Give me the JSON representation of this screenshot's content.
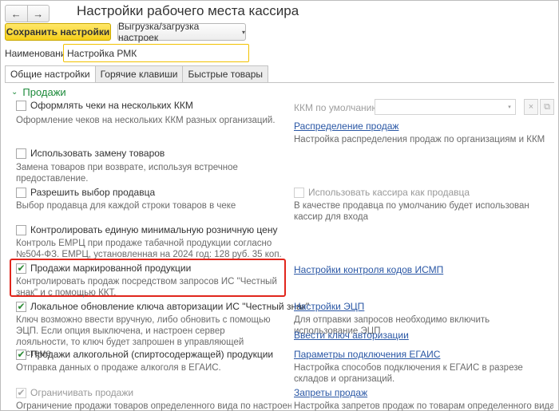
{
  "window": {
    "title": "Настройки рабочего места кассира",
    "nav_back": "←",
    "nav_forward": "→"
  },
  "toolbar": {
    "save_label": "Сохранить настройки",
    "export_label": "Выгрузка/загрузка настроек",
    "export_caret": "▾"
  },
  "name_field": {
    "label": "Наименование:",
    "value": "Настройка РМК"
  },
  "tabs": [
    {
      "label": "Общие настройки",
      "active": true
    },
    {
      "label": "Горячие клавиши",
      "active": false
    },
    {
      "label": "Быстрые товары",
      "active": false
    }
  ],
  "group": {
    "title": "Продажи",
    "chevron": "⌄"
  },
  "settings": [
    {
      "label": "Оформлять чеки на нескольких ККМ",
      "checked": false,
      "desc": "Оформление чеков на нескольких ККМ разных организаций."
    },
    {
      "label": "Использовать замену товаров",
      "checked": false,
      "desc": "Замена товаров при возврате, используя встречное предоставление."
    },
    {
      "label": "Разрешить выбор продавца",
      "checked": false,
      "desc": "Выбор продавца для каждой строки товаров в чеке"
    },
    {
      "label": "Контролировать единую минимальную розничную цену",
      "checked": false,
      "desc": "Контроль ЕМРЦ при продаже табачной продукции согласно №504-ФЗ. ЕМРЦ, установленная на 2024 год: 128 руб. 35 коп."
    },
    {
      "label": "Продажи маркированной продукции",
      "checked": true,
      "desc": "Контролировать продаж посредством запросов ИС \"Честный знак\" и с помощью ККТ."
    },
    {
      "label": "Локальное обновление ключа авторизации ИС \"Честный знак\"",
      "checked": true,
      "desc": "Ключ возможно ввести вручную, либо обновить с помощью ЭЦП. Если опция выключена, и настроен сервер лояльности, то ключ будет запрошен в управляющей системе."
    },
    {
      "label": "Продажи алкогольной (спиртосодержащей) продукции",
      "checked": true,
      "desc": "Отправка данных о продаже алкоголя в ЕГАИС."
    },
    {
      "label": "Ограничивать продажи",
      "checked": true,
      "disabled": true,
      "desc": "Ограничение продажи товаров определенного вида по настроенному"
    }
  ],
  "right": {
    "ktt_label": "ККМ по умолчанию:",
    "ktt_value": "",
    "ktt_caret": "▾",
    "open_icon_glyph": "⧉",
    "links": [
      {
        "label": "Распределение продаж",
        "desc": "Настройка распределения продаж по организациям и ККМ"
      },
      {
        "label": "Настройки контроля кодов ИСМП",
        "desc": ""
      },
      {
        "label": "Настройки ЭЦП",
        "desc": "Для отправки запросов необходимо включить использование ЭЦП"
      },
      {
        "label": "Ввести ключ авторизации",
        "desc": ""
      },
      {
        "label": "Параметры подключения ЕГАИС",
        "desc": "Настройка способов подключения к ЕГАИС в разрезе складов и организаций."
      },
      {
        "label": "Запреты продаж",
        "desc": "Настройка запретов продаж по товарам определенного вида"
      }
    ],
    "cashier_seller": {
      "label": "Использовать кассира как продавца",
      "checked": false,
      "disabled": true,
      "desc": "В качестве продавца по умолчанию будет использован кассир для входа"
    }
  },
  "checkmark": "✔"
}
